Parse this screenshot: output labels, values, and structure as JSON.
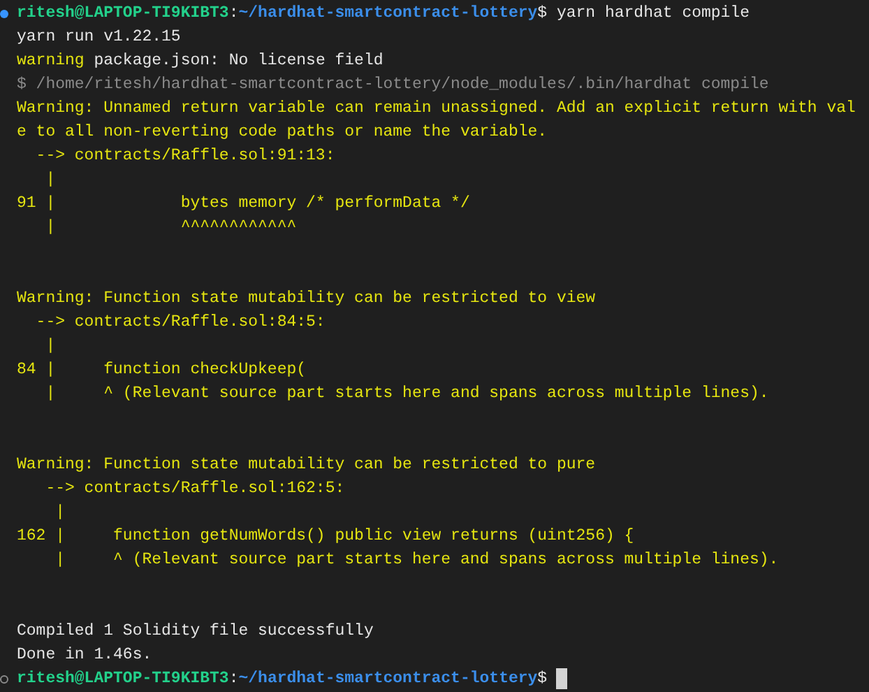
{
  "terminal": {
    "blocks": [
      {
        "lines": [
          {
            "prompt": true,
            "command_finished": true,
            "segments": [
              {
                "text": "ritesh@LAPTOP-TI9KIBT3",
                "kind": "user"
              },
              {
                "text": ":",
                "kind": "plain"
              },
              {
                "text": "~/hardhat-smartcontract-lottery",
                "kind": "path"
              },
              {
                "text": "$ yarn hardhat compile",
                "kind": "plain"
              }
            ]
          },
          {
            "segments": [
              {
                "text": "yarn run v1.22.15",
                "kind": "plain"
              }
            ]
          },
          {
            "segments": [
              {
                "text": "warning",
                "kind": "warning"
              },
              {
                "text": " package.json: No license field",
                "kind": "plain"
              }
            ]
          },
          {
            "segments": [
              {
                "text": "$ /home/ritesh/hardhat-smartcontract-lottery/node_modules/.bin/hardhat compile",
                "kind": "muted"
              }
            ]
          },
          {
            "segments": [
              {
                "text": "Warning: Unnamed return variable can remain unassigned. Add an explicit return with val",
                "kind": "warning"
              }
            ]
          },
          {
            "segments": [
              {
                "text": "e to all non-reverting code paths or name the variable.",
                "kind": "warning"
              }
            ]
          },
          {
            "segments": [
              {
                "text": "  --> contracts/Raffle.sol:91:13:",
                "kind": "warning"
              }
            ]
          },
          {
            "segments": [
              {
                "text": "   |",
                "kind": "warning"
              }
            ]
          },
          {
            "segments": [
              {
                "text": "91 |             bytes memory /* performData */",
                "kind": "warning"
              }
            ]
          },
          {
            "segments": [
              {
                "text": "   |             ^^^^^^^^^^^^",
                "kind": "warning"
              }
            ]
          }
        ]
      },
      {
        "lines": [
          {
            "segments": [
              {
                "text": "Warning: Function state mutability can be restricted to view",
                "kind": "warning"
              }
            ]
          },
          {
            "segments": [
              {
                "text": "  --> contracts/Raffle.sol:84:5:",
                "kind": "warning"
              }
            ]
          },
          {
            "segments": [
              {
                "text": "   |",
                "kind": "warning"
              }
            ]
          },
          {
            "segments": [
              {
                "text": "84 |     function checkUpkeep(",
                "kind": "warning"
              }
            ]
          },
          {
            "segments": [
              {
                "text": "   |     ^ (Relevant source part starts here and spans across multiple lines).",
                "kind": "warning"
              }
            ]
          }
        ]
      },
      {
        "lines": [
          {
            "segments": [
              {
                "text": "Warning: Function state mutability can be restricted to pure",
                "kind": "warning"
              }
            ]
          },
          {
            "segments": [
              {
                "text": "   --> contracts/Raffle.sol:162:5:",
                "kind": "warning"
              }
            ]
          },
          {
            "segments": [
              {
                "text": "    |",
                "kind": "warning"
              }
            ]
          },
          {
            "segments": [
              {
                "text": "162 |     function getNumWords() public view returns (uint256) {",
                "kind": "warning"
              }
            ]
          },
          {
            "segments": [
              {
                "text": "    |     ^ (Relevant source part starts here and spans across multiple lines).",
                "kind": "warning"
              }
            ]
          }
        ]
      },
      {
        "lines": [
          {
            "segments": [
              {
                "text": "Compiled 1 Solidity file successfully",
                "kind": "plain"
              }
            ]
          },
          {
            "segments": [
              {
                "text": "Done in 1.46s.",
                "kind": "plain"
              }
            ]
          },
          {
            "prompt": true,
            "command_finished": false,
            "cursor": true,
            "segments": [
              {
                "text": "ritesh@LAPTOP-TI9KIBT3",
                "kind": "user"
              },
              {
                "text": ":",
                "kind": "plain"
              },
              {
                "text": "~/hardhat-smartcontract-lottery",
                "kind": "path"
              },
              {
                "text": "$ ",
                "kind": "plain"
              }
            ]
          }
        ]
      }
    ]
  }
}
